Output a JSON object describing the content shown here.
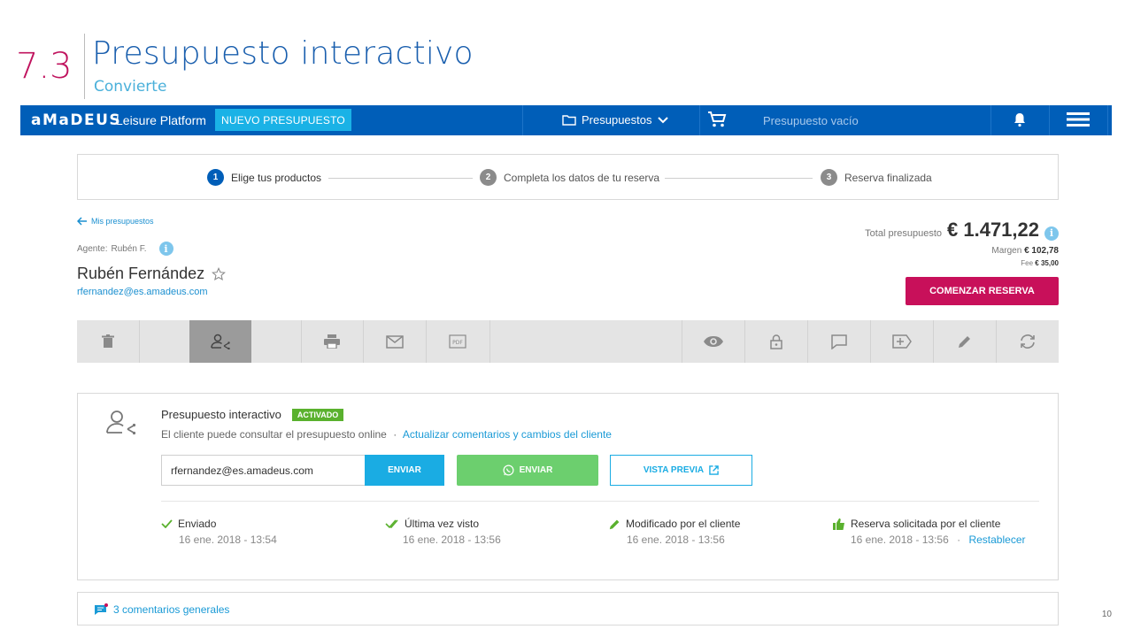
{
  "slide": {
    "number": "7.3",
    "title": "Presupuesto interactivo",
    "subtitle": "Convierte",
    "page_number": "10"
  },
  "navbar": {
    "brand": "aMaDEUS",
    "brand_sub": "Leisure Platform",
    "new_budget_button": "NUEVO PRESUPUESTO",
    "budgets_menu": "Presupuestos",
    "cart_status": "Presupuesto vacío"
  },
  "stepper": {
    "steps": [
      {
        "number": "1",
        "label": "Elige tus productos"
      },
      {
        "number": "2",
        "label": "Completa los datos de tu reserva"
      },
      {
        "number": "3",
        "label": "Reserva finalizada"
      }
    ]
  },
  "budget": {
    "back_link": "Mis presupuestos",
    "agent_label": "Agente:",
    "agent_name": "Rubén F.",
    "client_name": "Rubén Fernández",
    "client_email": "rfernandez@es.amadeus.com",
    "total_label": "Total presupuesto",
    "total_value": "€ 1.471,22",
    "margin_label": "Margen",
    "margin_value": "€ 102,78",
    "fee_label": "Fee",
    "fee_value": "€ 35,00",
    "start_booking_button": "COMENZAR RESERVA"
  },
  "interactive": {
    "title": "Presupuesto interactivo",
    "badge": "ACTIVADO",
    "description": "El cliente puede consultar el presupuesto online",
    "separator": "·",
    "update_link": "Actualizar comentarios y cambios del cliente",
    "email_value": "rfernandez@es.amadeus.com",
    "send_button": "ENVIAR",
    "whatsapp_button": "ENVIAR",
    "preview_button": "VISTA PREVIA",
    "statuses": [
      {
        "label": "Enviado",
        "date": "16 ene. 2018 - 13:54"
      },
      {
        "label": "Última vez visto",
        "date": "16 ene. 2018 - 13:56"
      },
      {
        "label": "Modificado por el cliente",
        "date": "16 ene. 2018 - 13:56"
      },
      {
        "label": "Reserva solicitada por el cliente",
        "date": "16 ene. 2018 - 13:56",
        "link": "Restablecer"
      }
    ]
  },
  "comments": {
    "label": "3 comentarios generales"
  },
  "colors": {
    "brand_blue": "#005eb8",
    "accent_cyan": "#1ab2e6",
    "primary_magenta": "#c8105a",
    "success_green": "#5ab12e",
    "whatsapp_green": "#6ccf6e"
  }
}
